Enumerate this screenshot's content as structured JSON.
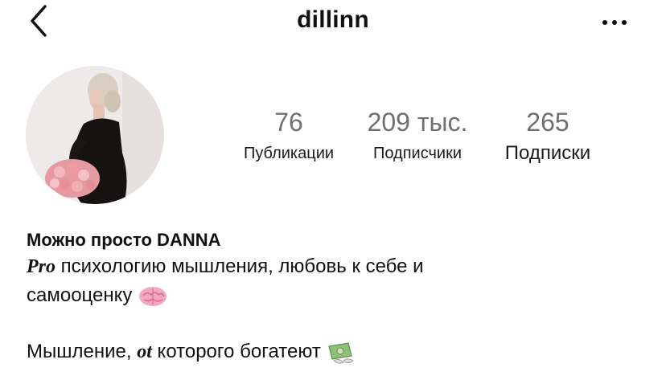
{
  "header": {
    "username": "dillinn"
  },
  "icons": {
    "back": "chevron-left-icon",
    "more": "more-horizontal-icon"
  },
  "stats": {
    "posts": {
      "value": "76",
      "label": "Публикации"
    },
    "followers": {
      "value": "209 тыс.",
      "label": "Подписчики"
    },
    "following": {
      "value": "265",
      "label": "Подписки"
    }
  },
  "bio": {
    "name": "Можно просто DANNA",
    "line1_prefix": "Pro",
    "line1_text": " психологию мышления, любовь к себе и",
    "line2_text": "самооценку ",
    "line3_prefix": "Мышление, ",
    "line3_styled": "ot",
    "line3_suffix": " которого богатеют "
  },
  "emojis": {
    "brain": "brain-emoji",
    "money": "money-with-wings-emoji"
  }
}
